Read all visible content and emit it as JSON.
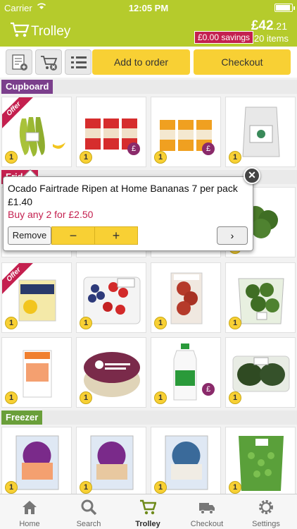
{
  "status_bar": {
    "carrier": "Carrier",
    "time": "12:05 PM"
  },
  "header": {
    "title": "Trolley",
    "total_main": "£42",
    "total_decimal": ".21",
    "savings": "£0.00 savings",
    "items": "20 items"
  },
  "toolbar": {
    "add_to_order": "Add to order",
    "checkout": "Checkout"
  },
  "categories": {
    "cupboard": "Cupboard",
    "fridge": "Fridge",
    "freezer": "Freezer"
  },
  "colors": {
    "brand_green": "#b5cb2c",
    "accent_yellow": "#f8d034",
    "offer_pink": "#c4204f",
    "cupboard": "#7b3f8c",
    "fridge": "#c4204f",
    "freezer": "#6a9f3a"
  },
  "tiles": {
    "qty": "1",
    "offer": "Offer",
    "pound": "£"
  },
  "popup": {
    "name": "Ocado Fairtrade Ripen at Home Bananas 7 per pack",
    "price": "£1.40",
    "offer": "Buy any 2 for £2.50",
    "remove": "Remove",
    "minus": "−",
    "plus": "+",
    "next": "›",
    "close": "✕"
  },
  "tabbar": {
    "home": "Home",
    "search": "Search",
    "trolley": "Trolley",
    "checkout": "Checkout",
    "settings": "Settings"
  }
}
